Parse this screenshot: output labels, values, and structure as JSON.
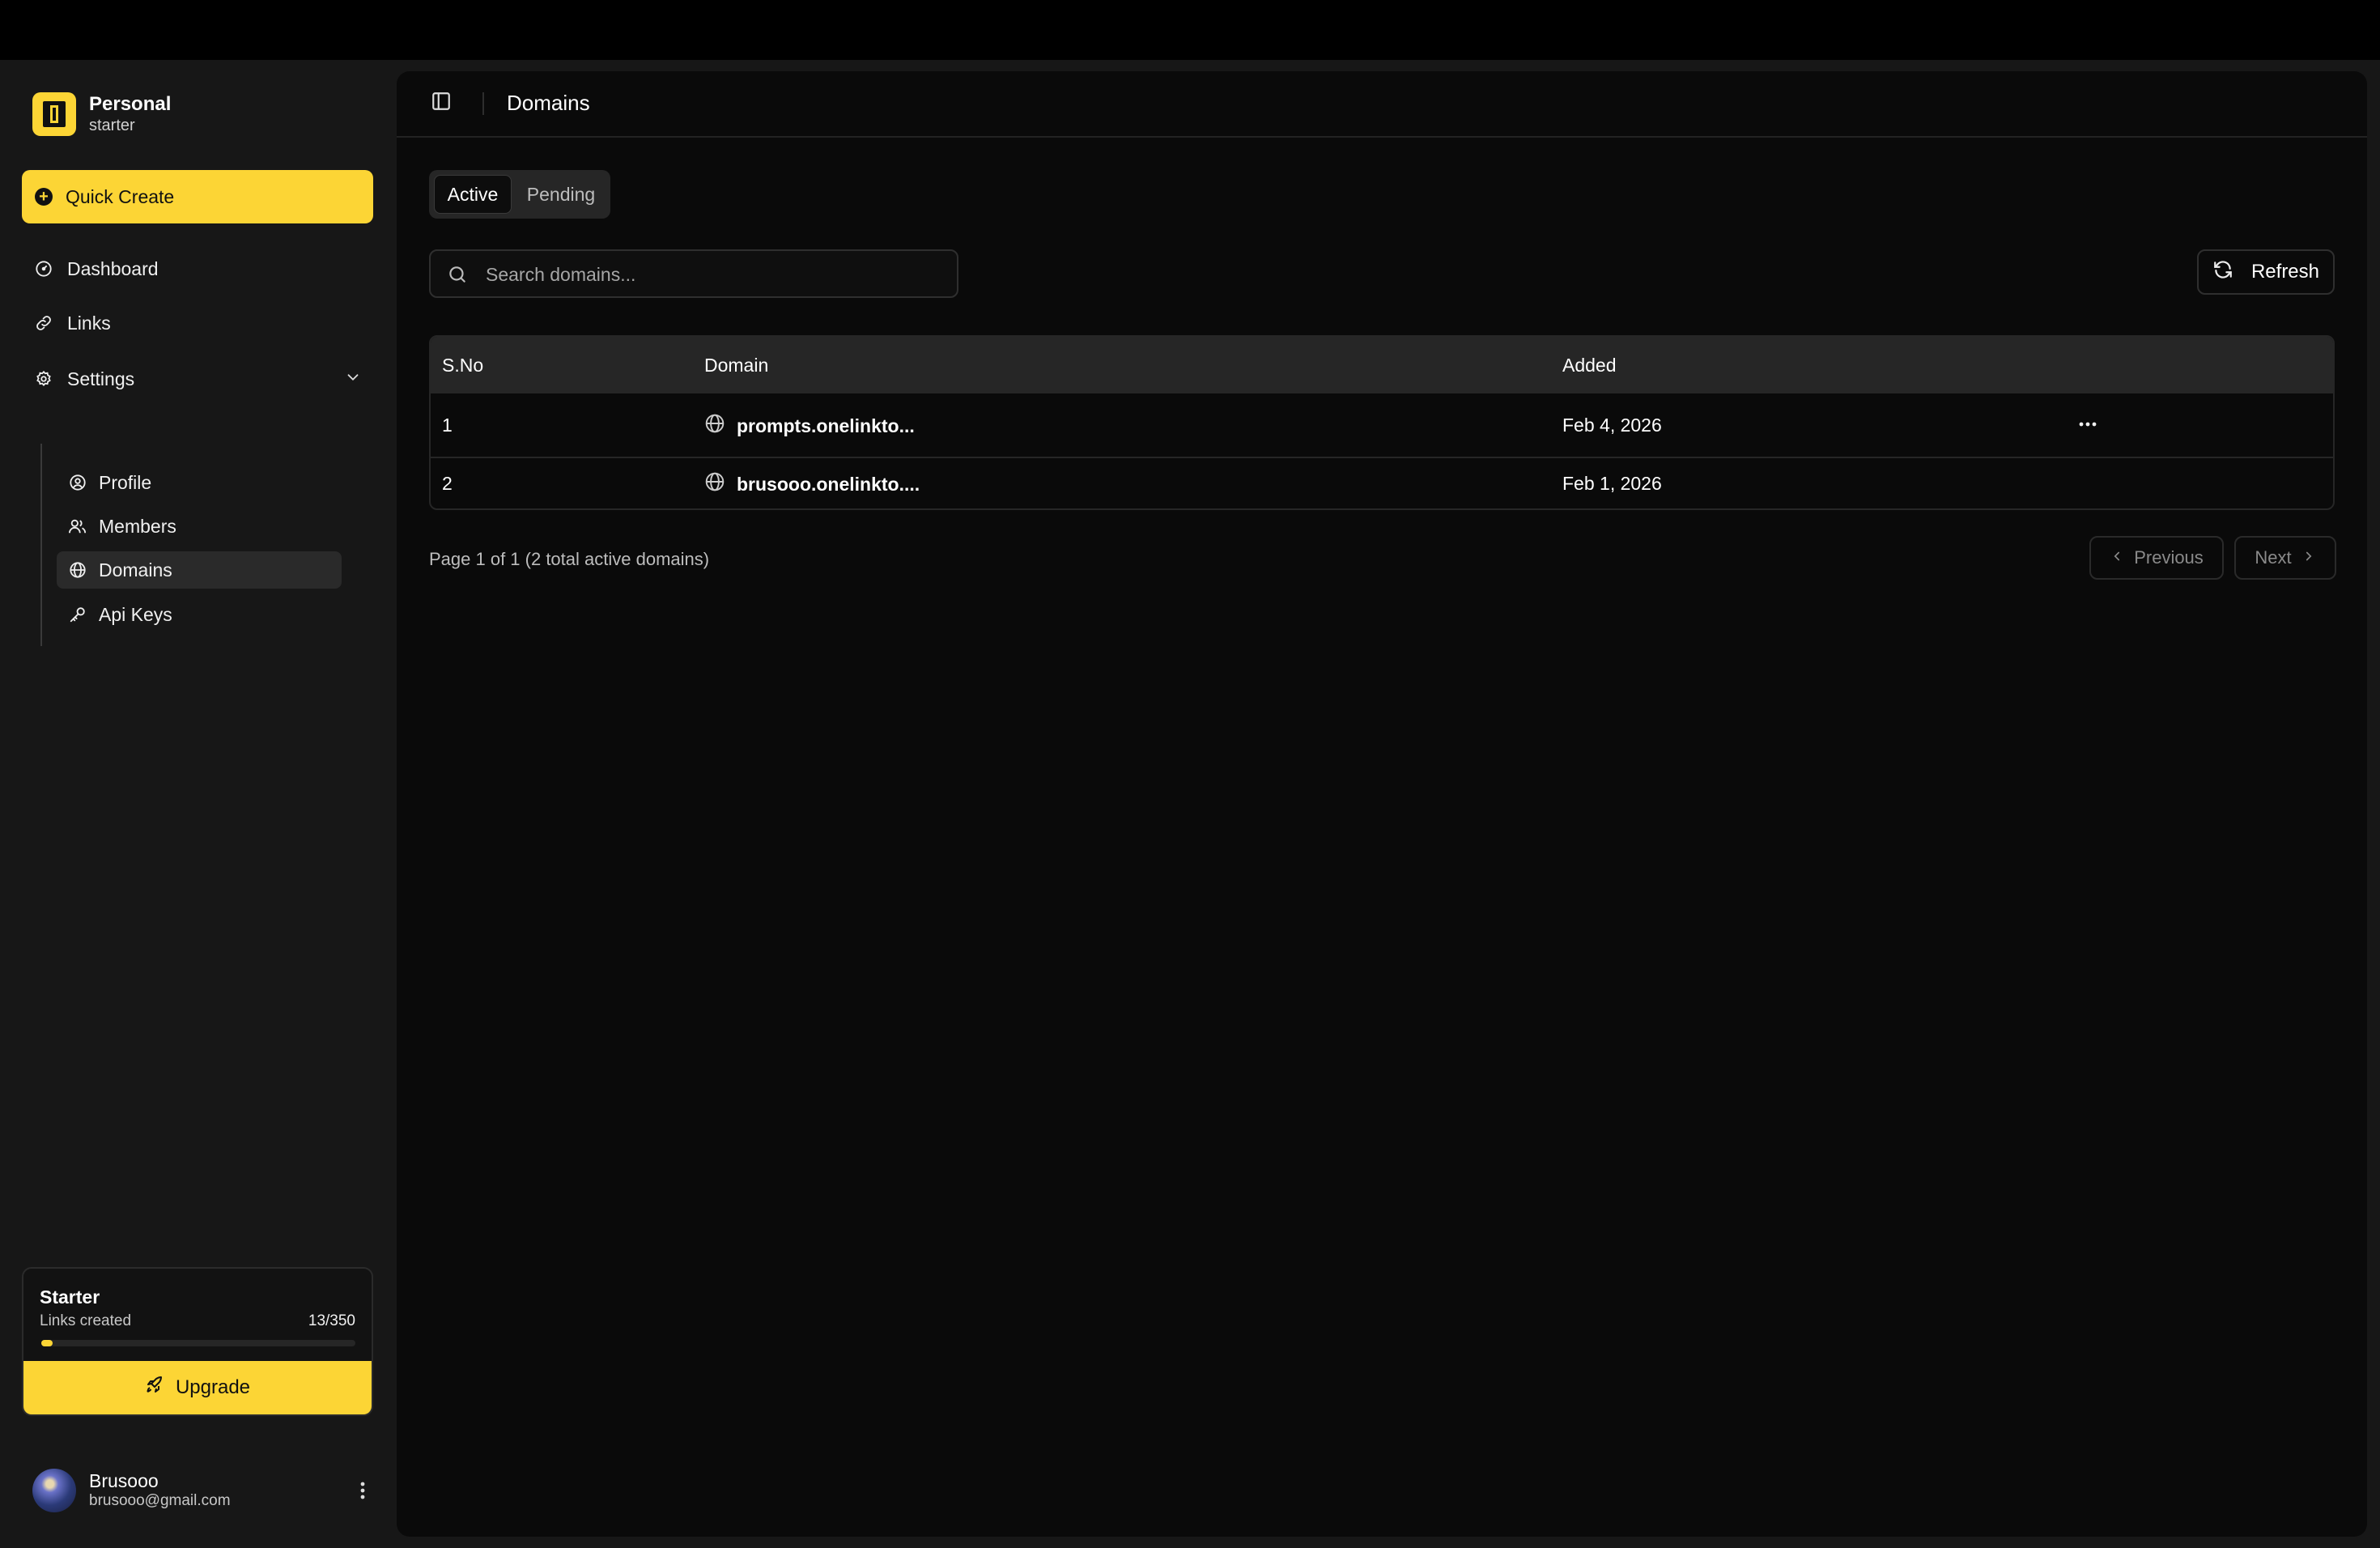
{
  "workspace": {
    "name": "Personal",
    "plan": "starter"
  },
  "sidebar": {
    "quick_create": "Quick Create",
    "items": [
      {
        "label": "Dashboard",
        "icon": "gauge-icon"
      },
      {
        "label": "Links",
        "icon": "link-icon"
      },
      {
        "label": "Settings",
        "icon": "gear-icon"
      }
    ],
    "settings_sub": [
      {
        "label": "Profile",
        "icon": "user-circle-icon"
      },
      {
        "label": "Members",
        "icon": "users-icon"
      },
      {
        "label": "Domains",
        "icon": "globe-icon"
      },
      {
        "label": "Api Keys",
        "icon": "key-icon"
      }
    ],
    "plan_card": {
      "title": "Starter",
      "subtitle": "Links created",
      "count": "13/350",
      "progress": 0.037,
      "upgrade_label": "Upgrade"
    },
    "user": {
      "name": "Brusooo",
      "email": "brusooo@gmail.com"
    }
  },
  "header": {
    "title": "Domains"
  },
  "tabs": {
    "active": "Active",
    "pending": "Pending"
  },
  "search": {
    "placeholder": "Search domains..."
  },
  "refresh_label": "Refresh",
  "table": {
    "headers": {
      "sno": "S.No",
      "domain": "Domain",
      "added": "Added"
    },
    "rows": [
      {
        "sno": "1",
        "domain": "prompts.onelinkto...",
        "added": "Feb 4, 2026"
      },
      {
        "sno": "2",
        "domain": "brusooo.onelinkto....",
        "added": "Feb 1, 2026"
      }
    ]
  },
  "pagination": {
    "info": "Page 1 of 1 (2 total active domains)",
    "prev": "Previous",
    "next": "Next"
  },
  "colors": {
    "accent": "#fcd535",
    "background": "#0a0a0a",
    "sidebar": "#171717"
  }
}
